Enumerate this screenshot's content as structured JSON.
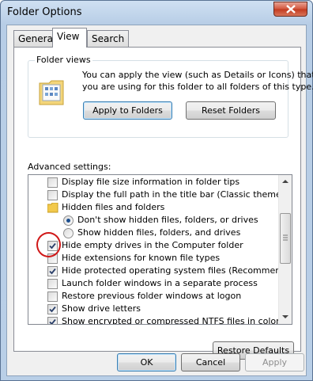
{
  "window": {
    "title": "Folder Options"
  },
  "tabs": [
    {
      "label": "General"
    },
    {
      "label": "View"
    },
    {
      "label": "Search"
    }
  ],
  "folder_views": {
    "title": "Folder views",
    "description_line1": "You can apply the view (such as Details or Icons) that",
    "description_line2": "you are using for this folder to all folders of this type.",
    "apply_label": "Apply to Folders",
    "reset_label": "Reset Folders"
  },
  "advanced": {
    "title": "Advanced settings:",
    "items": [
      {
        "label": "Display file size information in folder tips",
        "kind": "checkbox",
        "checked": false
      },
      {
        "label": "Display the full path in the title bar (Classic theme only)",
        "kind": "checkbox",
        "checked": false
      },
      {
        "label": "Hidden files and folders",
        "kind": "folder",
        "checked": false
      },
      {
        "label": "Don't show hidden files, folders, or drives",
        "kind": "radio",
        "checked": true
      },
      {
        "label": "Show hidden files, folders, and drives",
        "kind": "radio",
        "checked": false
      },
      {
        "label": "Hide empty drives in the Computer folder",
        "kind": "checkbox",
        "checked": true
      },
      {
        "label": "Hide extensions for known file types",
        "kind": "checkbox",
        "checked": false
      },
      {
        "label": "Hide protected operating system files (Recommended)",
        "kind": "checkbox",
        "checked": true
      },
      {
        "label": "Launch folder windows in a separate process",
        "kind": "checkbox",
        "checked": false
      },
      {
        "label": "Restore previous folder windows at logon",
        "kind": "checkbox",
        "checked": false
      },
      {
        "label": "Show drive letters",
        "kind": "checkbox",
        "checked": true
      },
      {
        "label": "Show encrypted or compressed NTFS files in color",
        "kind": "checkbox",
        "checked": true
      }
    ]
  },
  "restore_defaults_label": "Restore Defaults",
  "footer": {
    "ok_label": "OK",
    "cancel_label": "Cancel",
    "apply_label": "Apply"
  }
}
